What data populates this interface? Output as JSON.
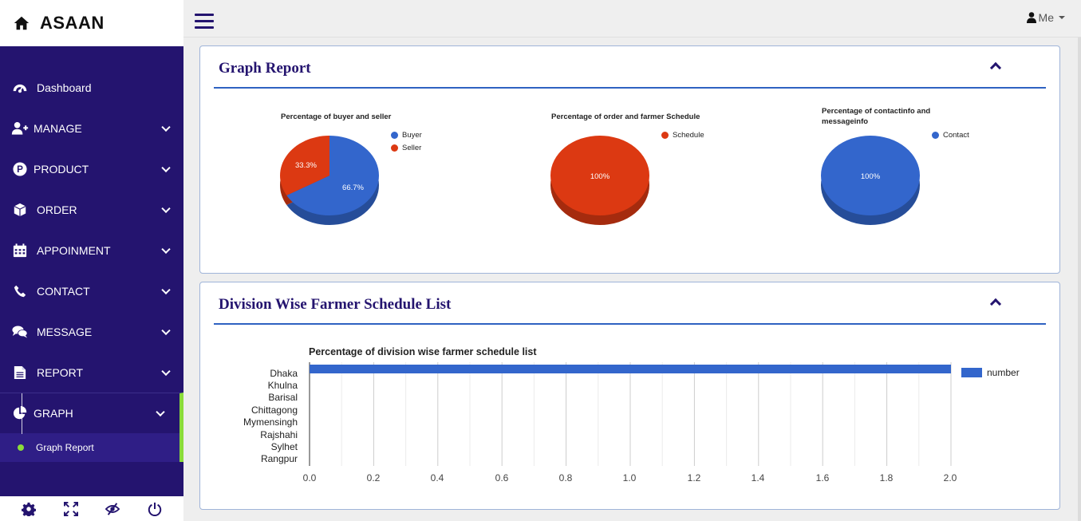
{
  "brand": {
    "name": "ASAAN"
  },
  "nav": [
    {
      "label": "Dashboard",
      "icon": "dashboard-icon",
      "has_children": false
    },
    {
      "label": "MANAGE",
      "icon": "user-plus-icon",
      "has_children": true
    },
    {
      "label": "PRODUCT",
      "icon": "product-p-icon",
      "has_children": true
    },
    {
      "label": "ORDER",
      "icon": "cube-icon",
      "has_children": true
    },
    {
      "label": "APPOINMENT",
      "icon": "calendar-icon",
      "has_children": true
    },
    {
      "label": "CONTACT",
      "icon": "phone-icon",
      "has_children": true
    },
    {
      "label": "MESSAGE",
      "icon": "comments-icon",
      "has_children": true
    },
    {
      "label": "REPORT",
      "icon": "document-icon",
      "has_children": true
    },
    {
      "label": "GRAPH",
      "icon": "pie-chart-icon",
      "has_children": true,
      "active": true
    }
  ],
  "subnav": {
    "label": "Graph Report"
  },
  "footer_icons": [
    "settings-icon",
    "fullscreen-icon",
    "hide-icon",
    "power-icon"
  ],
  "topbar": {
    "user_label": "Me"
  },
  "colors": {
    "sidebar": "#24146f",
    "accent": "#8bdc3a",
    "blue": "#3366cc",
    "red": "#dc3912",
    "title": "#24146f"
  },
  "graph_card": {
    "title": "Graph Report"
  },
  "division_card": {
    "title": "Division Wise Farmer Schedule List"
  },
  "chart_data": [
    {
      "type": "pie",
      "title": "Percentage of buyer and seller",
      "labels": [
        "Buyer",
        "Seller"
      ],
      "values": [
        66.7,
        33.3
      ],
      "slice_labels": [
        "66.7%",
        "33.3%"
      ],
      "colors": [
        "#3366cc",
        "#dc3912"
      ],
      "legend": "right"
    },
    {
      "type": "pie",
      "title": "Percentage of order and farmer Schedule",
      "labels": [
        "Schedule"
      ],
      "values": [
        100
      ],
      "slice_labels": [
        "100%"
      ],
      "colors": [
        "#dc3912"
      ],
      "legend": "right"
    },
    {
      "type": "pie",
      "title_lines": [
        "Percentage of contactinfo and",
        "messageinfo"
      ],
      "labels": [
        "Contact"
      ],
      "values": [
        100
      ],
      "slice_labels": [
        "100%"
      ],
      "colors": [
        "#3366cc"
      ],
      "legend": "right"
    },
    {
      "type": "bar",
      "orientation": "horizontal",
      "title": "Percentage of division wise farmer schedule list",
      "categories": [
        "Dhaka",
        "Khulna",
        "Barisal",
        "Chittagong",
        "Mymensingh",
        "Rajshahi",
        "Sylhet",
        "Rangpur"
      ],
      "series": [
        {
          "name": "number",
          "values": [
            2,
            0,
            0,
            0,
            0,
            0,
            0,
            0
          ]
        }
      ],
      "x_ticks": [
        "0.0",
        "0.2",
        "0.4",
        "0.6",
        "0.8",
        "1.0",
        "1.2",
        "1.4",
        "1.6",
        "1.8",
        "2.0"
      ],
      "xlim": [
        0,
        2
      ],
      "grid": true,
      "legend": "right",
      "color": "#3366cc"
    }
  ]
}
